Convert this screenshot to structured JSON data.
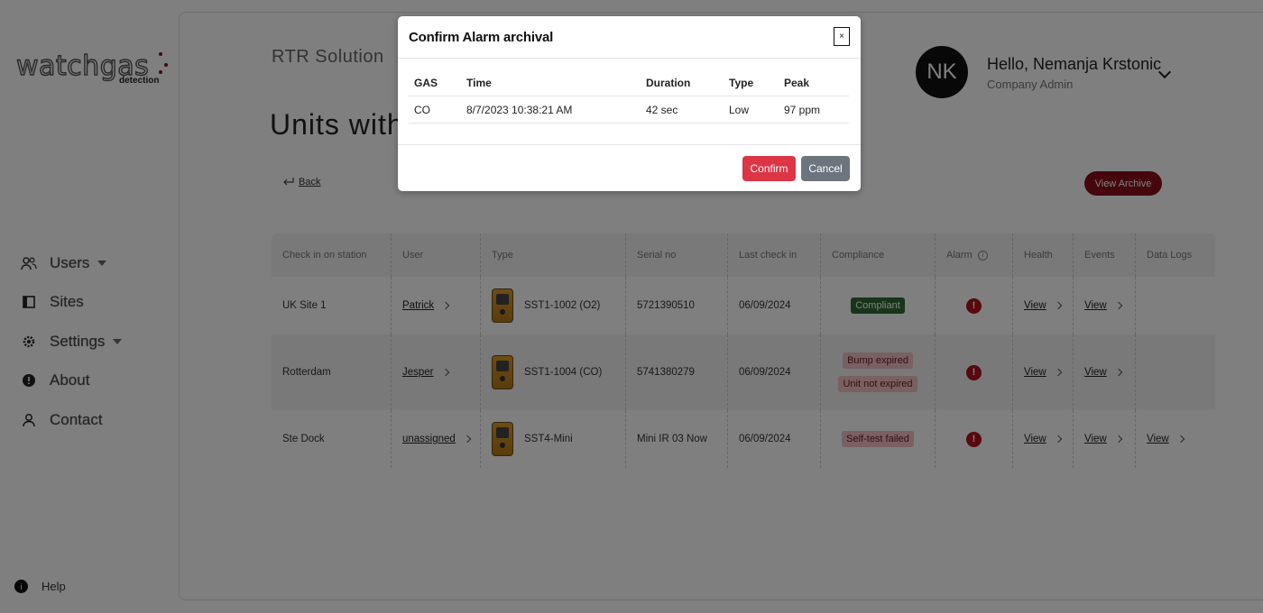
{
  "sidebar": {
    "logo_text": "watchgas",
    "logo_sub": "detection",
    "items": [
      {
        "label": "Users",
        "icon": "users-icon",
        "has_dropdown": true
      },
      {
        "label": "Sites",
        "icon": "book-icon",
        "has_dropdown": false
      },
      {
        "label": "Settings",
        "icon": "gear-icon",
        "has_dropdown": true
      },
      {
        "label": "About",
        "icon": "info-circle-icon",
        "has_dropdown": false
      },
      {
        "label": "Contact",
        "icon": "person-icon",
        "has_dropdown": false
      }
    ],
    "help_label": "Help"
  },
  "header": {
    "company": "RTR Solution",
    "page_title": "Units with",
    "avatar_initials": "NK",
    "greeting": "Hello, Nemanja Krstonic",
    "role": "Company Admin"
  },
  "toolbar": {
    "back_label": "Back",
    "view_archive_label": "View Archive"
  },
  "table": {
    "headers": [
      "Check in on station",
      "User",
      "Type",
      "Serial no",
      "Last check in",
      "Compliance",
      "Alarm",
      "Health",
      "Events",
      "Data Logs"
    ],
    "rows": [
      {
        "station": "UK Site 1",
        "user": "Patrick",
        "type": "SST1-1002 (O2)",
        "serial": "5721390510",
        "last_check_in": "06/09/2024",
        "compliance": [
          "Compliant"
        ],
        "health": "View",
        "events": "View",
        "data_logs": ""
      },
      {
        "station": "Rotterdam",
        "user": "Jesper",
        "type": "SST1-1004 (CO)",
        "serial": "5741380279",
        "last_check_in": "06/09/2024",
        "compliance": [
          "Bump expired",
          "Unit not expired"
        ],
        "health": "View",
        "events": "View",
        "data_logs": ""
      },
      {
        "station": "Ste Dock",
        "user": "unassigned",
        "type": "SST4-Mini",
        "serial": "Mini IR 03 Now",
        "last_check_in": "06/09/2024",
        "compliance": [
          "Self-test failed"
        ],
        "health": "View",
        "events": "View",
        "data_logs": "View"
      }
    ]
  },
  "modal": {
    "title": "Confirm Alarm archival",
    "close_label": "×",
    "headers": [
      "GAS",
      "Time",
      "Duration",
      "Type",
      "Peak"
    ],
    "rows": [
      {
        "gas": "CO",
        "time": "8/7/2023 10:38:21 AM",
        "duration": "42 sec",
        "type": "Low",
        "peak": "97 ppm"
      }
    ],
    "confirm_label": "Confirm",
    "cancel_label": "Cancel"
  },
  "colors": {
    "brand_red": "#8a0f1b",
    "confirm_red": "#dc3545",
    "cancel_gray": "#6c757d",
    "compliant_green": "#2e6b34",
    "alarm_red": "#b0101c"
  }
}
